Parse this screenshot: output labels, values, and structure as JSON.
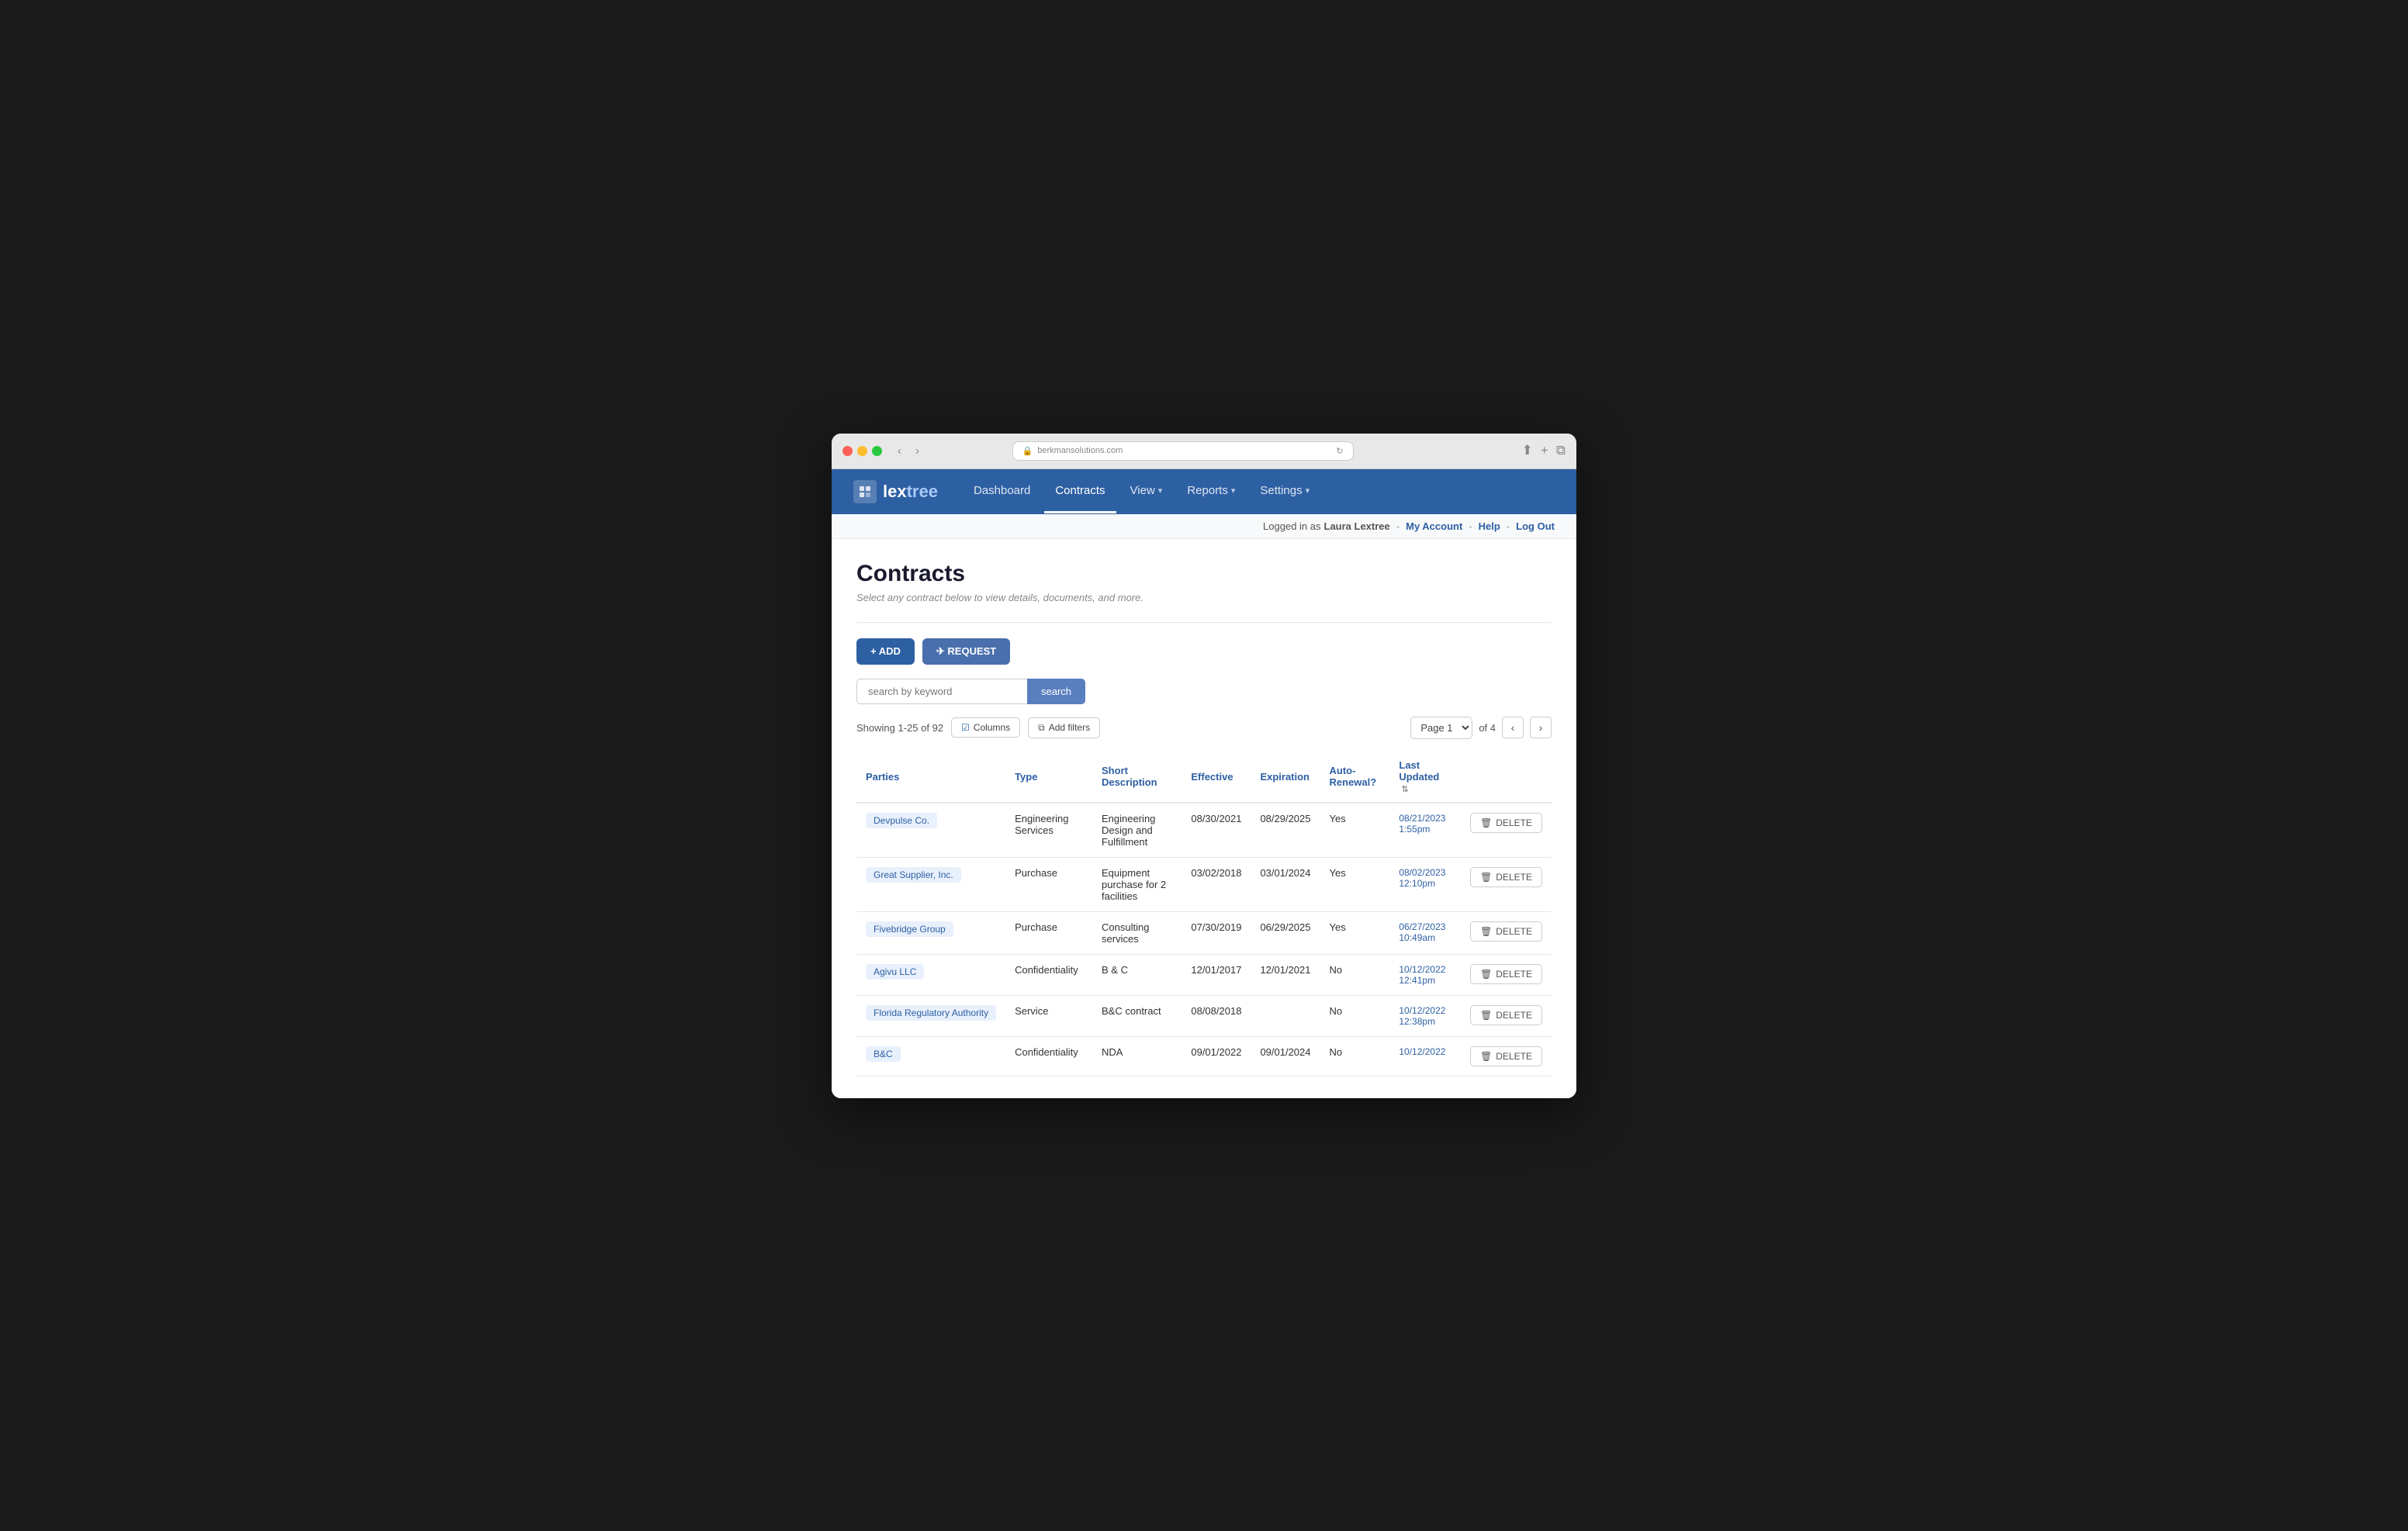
{
  "browser": {
    "url": "berkmansolutions.com",
    "back_label": "‹",
    "forward_label": "›",
    "reload_label": "↻"
  },
  "nav": {
    "logo_text_lex": "lex",
    "logo_text_tree": "tree",
    "links": [
      {
        "label": "Dashboard",
        "active": false
      },
      {
        "label": "Contracts",
        "active": true
      },
      {
        "label": "View",
        "active": false,
        "dropdown": true
      },
      {
        "label": "Reports",
        "active": false,
        "dropdown": true
      },
      {
        "label": "Settings",
        "active": false,
        "dropdown": true
      }
    ]
  },
  "topbar": {
    "logged_in_prefix": "Logged in as ",
    "user_name": "Laura Lextree",
    "my_account": "My Account",
    "help": "Help",
    "log_out": "Log Out"
  },
  "page": {
    "title": "Contracts",
    "subtitle": "Select any contract below to view details, documents, and more.",
    "add_label": "+ ADD",
    "request_label": "✈ REQUEST",
    "search_placeholder": "search by keyword",
    "search_button": "search",
    "showing_text": "Showing 1-25 of 92",
    "columns_label": "Columns",
    "add_filters_label": "Add filters",
    "page_label": "Page 1",
    "of_label": "of 4"
  },
  "table": {
    "columns": [
      {
        "label": "Parties",
        "sortable": true
      },
      {
        "label": "Type",
        "sortable": true
      },
      {
        "label": "Short Description",
        "sortable": true
      },
      {
        "label": "Effective",
        "sortable": true
      },
      {
        "label": "Expiration",
        "sortable": true
      },
      {
        "label": "Auto-Renewal?",
        "sortable": true
      },
      {
        "label": "Last Updated",
        "sortable": true
      },
      {
        "label": "",
        "sortable": false
      }
    ],
    "rows": [
      {
        "party": "Devpulse Co.",
        "type": "Engineering Services",
        "description": "Engineering Design and Fulfillment",
        "effective": "08/30/2021",
        "expiration": "08/29/2025",
        "auto_renewal": "Yes",
        "last_updated": "08/21/2023 1:55pm",
        "delete_label": "DELETE"
      },
      {
        "party": "Great Supplier, Inc.",
        "type": "Purchase",
        "description": "Equipment purchase for 2 facilities",
        "effective": "03/02/2018",
        "expiration": "03/01/2024",
        "auto_renewal": "Yes",
        "last_updated": "08/02/2023 12:10pm",
        "delete_label": "DELETE"
      },
      {
        "party": "Fivebridge Group",
        "type": "Purchase",
        "description": "Consulting services",
        "effective": "07/30/2019",
        "expiration": "06/29/2025",
        "auto_renewal": "Yes",
        "last_updated": "06/27/2023 10:49am",
        "delete_label": "DELETE"
      },
      {
        "party": "Agivu LLC",
        "type": "Confidentiality",
        "description": "B & C",
        "effective": "12/01/2017",
        "expiration": "12/01/2021",
        "auto_renewal": "No",
        "last_updated": "10/12/2022 12:41pm",
        "delete_label": "DELETE"
      },
      {
        "party": "Florida Regulatory Authority",
        "type": "Service",
        "description": "B&C contract",
        "effective": "08/08/2018",
        "expiration": "",
        "auto_renewal": "No",
        "last_updated": "10/12/2022 12:38pm",
        "delete_label": "DELETE"
      },
      {
        "party": "B&C",
        "type": "Confidentiality",
        "description": "NDA",
        "effective": "09/01/2022",
        "expiration": "09/01/2024",
        "auto_renewal": "No",
        "last_updated": "10/12/2022",
        "delete_label": "DELETE"
      }
    ]
  }
}
